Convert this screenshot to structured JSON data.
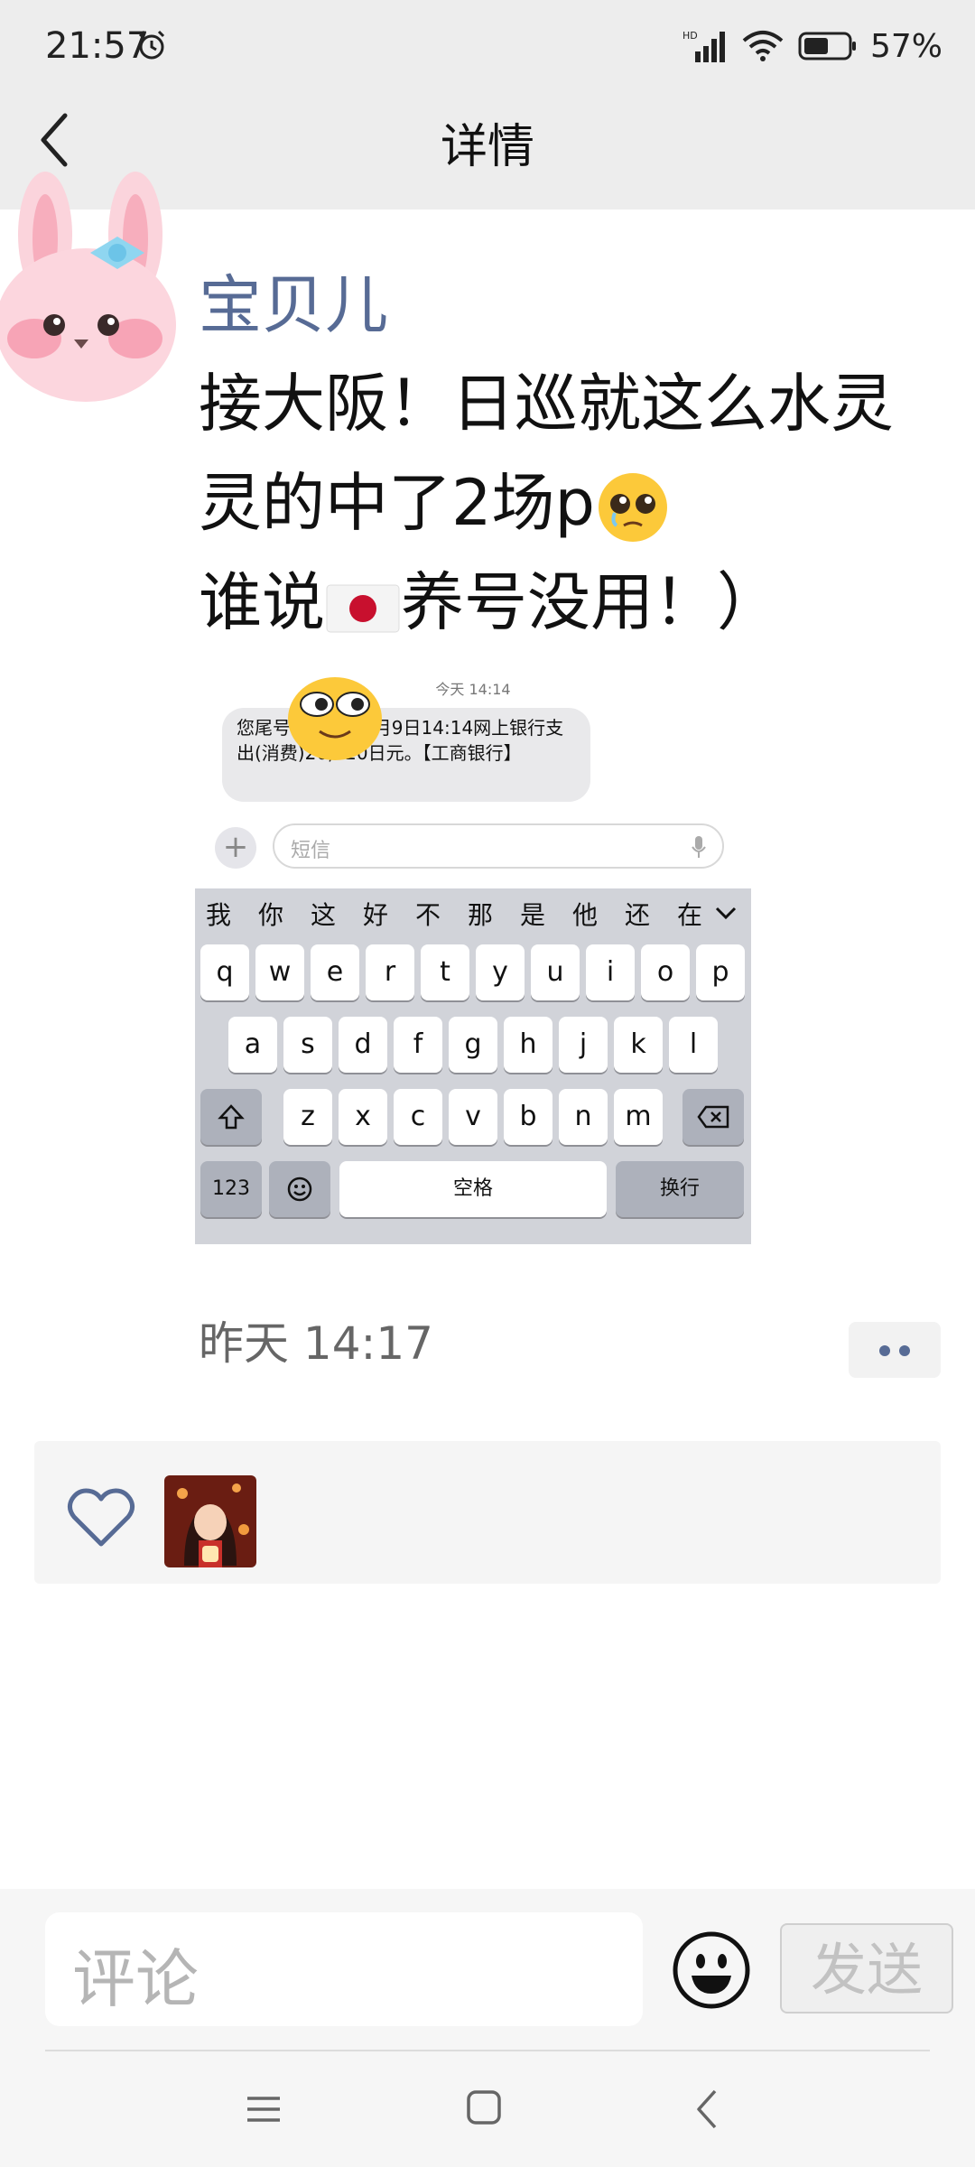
{
  "status": {
    "time": "21:57",
    "battery": "57%",
    "network": "HD"
  },
  "header": {
    "title": "详情"
  },
  "post": {
    "author": "宝贝儿",
    "text_lines": [
      "接大阪！日巡就这么水灵",
      "灵的中了2场p",
      "谁说",
      "养号没用！）"
    ],
    "date": "昨天 14:17"
  },
  "screenshot": {
    "sms_time": "今天 14:14",
    "sms_message": "您尾号    信用卡10月9日14:14网上银行支出(消费)26,320日元。【工商银行】",
    "input_placeholder": "短信",
    "candidates": [
      "我",
      "你",
      "这",
      "好",
      "不",
      "那",
      "是",
      "他",
      "还",
      "在"
    ],
    "row1": [
      "q",
      "w",
      "e",
      "r",
      "t",
      "y",
      "u",
      "i",
      "o",
      "p"
    ],
    "row2": [
      "a",
      "s",
      "d",
      "f",
      "g",
      "h",
      "j",
      "k",
      "l"
    ],
    "row3": [
      "z",
      "x",
      "c",
      "v",
      "b",
      "n",
      "m"
    ],
    "numbers_key": "123",
    "space_key": "空格",
    "return_key": "换行"
  },
  "comment_bar": {
    "placeholder": "评论",
    "send_label": "发送"
  },
  "icons": [
    "back-icon",
    "alarm-icon",
    "signal-icon",
    "wifi-icon",
    "battery-icon",
    "heart-icon",
    "smile-icon",
    "menu-icon",
    "home-icon",
    "nav-back-icon"
  ],
  "colors": {
    "author": "#576b95",
    "topbar": "#ededed",
    "likes_bg": "#f5f5f5"
  }
}
